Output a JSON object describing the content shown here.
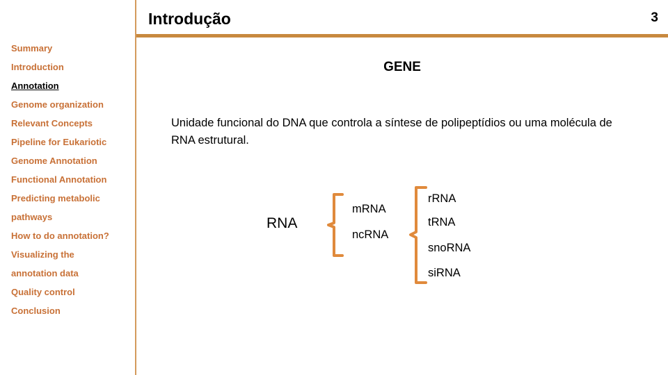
{
  "slide": {
    "title": "Introdução",
    "number": "3",
    "accent_color": "#c8893f",
    "divider_color": "#d49a5c",
    "nav_color": "#c87137",
    "active_color": "#000000"
  },
  "sidebar": {
    "items": [
      {
        "label": "Summary",
        "active": false
      },
      {
        "label": "Introduction",
        "active": false
      },
      {
        "label": "Annotation",
        "active": true
      },
      {
        "label": "Genome organization",
        "active": false
      },
      {
        "label": "Relevant Concepts",
        "active": false
      },
      {
        "label": "Pipeline for Eukariotic",
        "active": false
      },
      {
        "label": "Genome Annotation",
        "active": false
      },
      {
        "label": "Functional Annotation",
        "active": false
      },
      {
        "label": "Predicting metabolic",
        "active": false
      },
      {
        "label": "pathways",
        "active": false
      },
      {
        "label": "How to do annotation?",
        "active": false
      },
      {
        "label": "Visualizing the",
        "active": false
      },
      {
        "label": "annotation data",
        "active": false
      },
      {
        "label": "Quality control",
        "active": false
      },
      {
        "label": "Conclusion",
        "active": false
      }
    ]
  },
  "main": {
    "heading": "GENE",
    "definition": "Unidade funcional do DNA que controla a síntese de polipeptídios ou uma molécula de RNA estrutural."
  },
  "diagram": {
    "root": "RNA",
    "branch_color": "#e08a3c",
    "level1": {
      "mrna": "mRNA",
      "ncrna": "ncRNA"
    },
    "level2": {
      "rrna": "rRNA",
      "trna": "tRNA",
      "snorna": "snoRNA",
      "sirna": "siRNA"
    }
  }
}
